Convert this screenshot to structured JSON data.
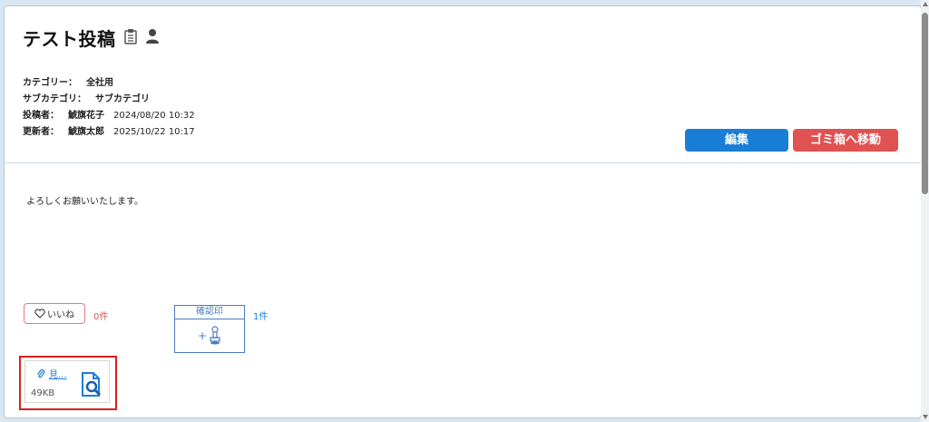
{
  "post": {
    "title": "テスト投稿",
    "icons": [
      "clipboard-icon",
      "person-icon"
    ]
  },
  "meta": {
    "category_label": "カテゴリー：",
    "category_value": "全社用",
    "subcategory_label": "サブカテゴリ：",
    "subcategory_value": "サブカテゴリ",
    "author_label": "投稿者：",
    "author_name": "鯱旗花子",
    "author_datetime": "2024/08/20 10:32",
    "updater_label": "更新者：",
    "updater_name": "鯱旗太郎",
    "updater_datetime": "2025/10/22 10:17"
  },
  "actions": {
    "edit_label": "編集",
    "trash_label": "ゴミ箱へ移動"
  },
  "body": {
    "text": "よろしくお願いいたします。"
  },
  "like": {
    "label": "いいね",
    "count": "0件"
  },
  "stamp": {
    "header": "確認印",
    "plus": "+",
    "count": "1件"
  },
  "attachment": {
    "name": "見...",
    "size": "49KB"
  },
  "colors": {
    "primary": "#1a7ed8",
    "danger": "#e05252",
    "highlight": "#d72020"
  }
}
